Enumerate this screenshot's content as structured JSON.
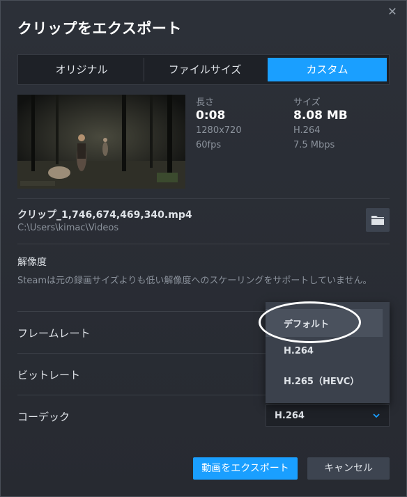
{
  "dialog": {
    "title": "クリップをエクスポート",
    "close_symbol": "✕"
  },
  "tabs": [
    {
      "label": "オリジナル",
      "active": false
    },
    {
      "label": "ファイルサイズ",
      "active": false
    },
    {
      "label": "カスタム",
      "active": true
    }
  ],
  "clip_info": {
    "length_label": "長さ",
    "length_value": "0:08",
    "resolution": "1280x720",
    "fps": "60fps",
    "size_label": "サイズ",
    "size_value": "8.08 MB",
    "codec": "H.264",
    "bitrate": "7.5 Mbps"
  },
  "file": {
    "name": "クリップ_1,746,674,469,340.mp4",
    "path": "C:\\Users\\kimac\\Videos",
    "folder_icon": "folder-icon"
  },
  "settings": {
    "resolution_label": "解像度",
    "resolution_note": "Steamは元の録画サイズよりも低い解像度へのスケーリングをサポートしていません。",
    "framerate_label": "フレームレート",
    "bitrate_label": "ビットレート",
    "codec_label": "コーデック",
    "codec_selected": "H.264",
    "codec_options": [
      "デフォルト",
      "H.264",
      "H.265（HEVC）"
    ]
  },
  "buttons": {
    "export": "動画をエクスポート",
    "cancel": "キャンセル"
  },
  "colors": {
    "accent": "#1a9fff",
    "dialog_bg": "#2a2e36",
    "dropdown_bg": "#3b414c"
  }
}
